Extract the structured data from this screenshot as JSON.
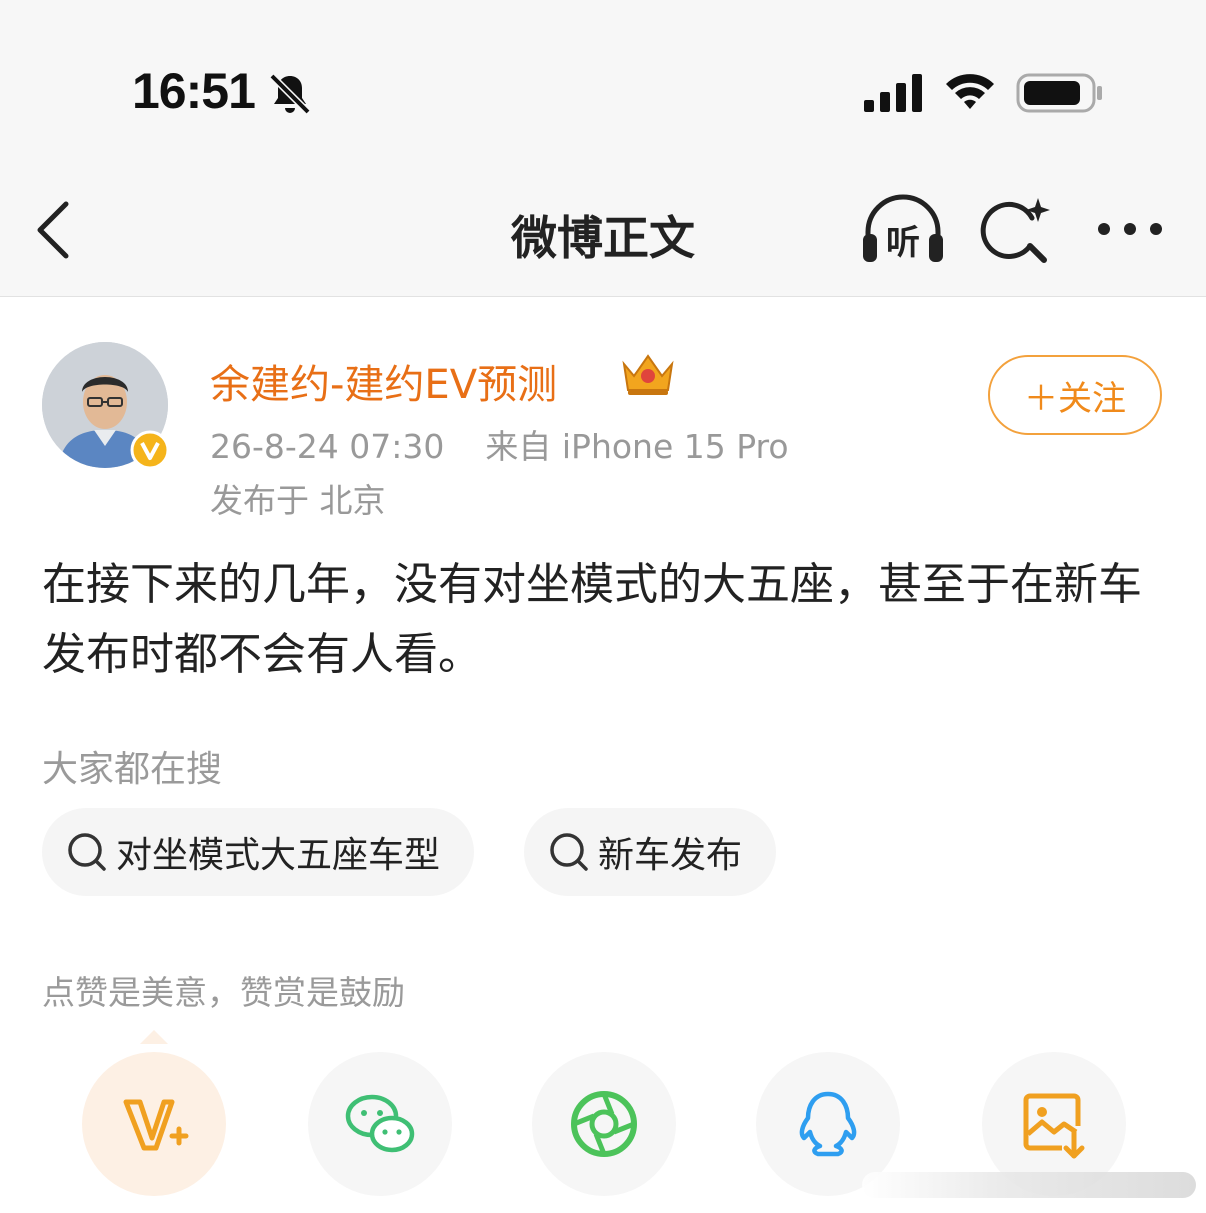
{
  "status_bar": {
    "time": "16:51",
    "icons": [
      "bell-slash-icon",
      "signal-icon",
      "wifi-icon",
      "battery-icon"
    ]
  },
  "nav": {
    "title": "微博正文",
    "icons": [
      "back-icon",
      "listen-icon",
      "ai-search-icon",
      "more-icon"
    ],
    "listen_label": "听"
  },
  "post": {
    "author": "余建约-建约EV预测",
    "timestamp": "26-8-24 07:30",
    "source": "来自 iPhone 15 Pro",
    "location": "发布于 北京",
    "follow_label": "＋关注",
    "content": "在接下来的几年，没有对坐模式的大五座，甚至于在新车发布时都不会有人看。"
  },
  "hot_search": {
    "title": "大家都在搜",
    "chips": [
      "对坐模式大五座车型",
      "新车发布"
    ]
  },
  "reward": {
    "note": "点赞是美意，赞赏是鼓励",
    "share_icons": [
      "v-plus-reward-icon",
      "wechat-icon",
      "moments-icon",
      "qq-icon",
      "save-image-icon"
    ]
  },
  "colors": {
    "accent_orange": "#e86f16",
    "follow_border": "#f3a13c",
    "wechat_green": "#3fbf74",
    "moments_green": "#4cc35a",
    "qq_blue": "#2e9ef0",
    "save_orange": "#f0a020"
  }
}
